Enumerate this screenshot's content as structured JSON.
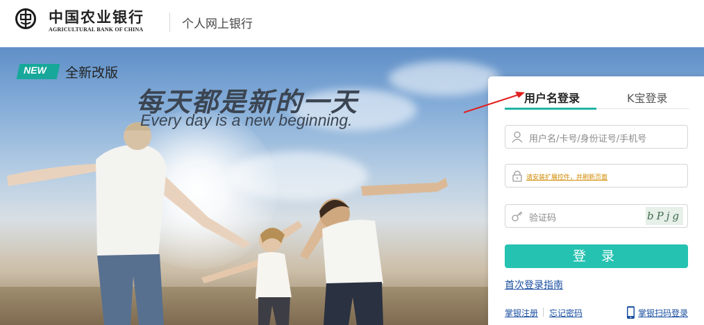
{
  "header": {
    "bank_name_cn": "中国农业银行",
    "bank_name_en": "AGRICULTURAL BANK OF CHINA",
    "section_title": "个人网上银行"
  },
  "banner": {
    "badge": "NEW",
    "badge_label": "全新改版",
    "slogan_cn": "每天都是新的一天",
    "slogan_en": "Every day is a new beginning."
  },
  "login": {
    "tabs": [
      {
        "label": "用户名登录",
        "active": true
      },
      {
        "label": "K宝登录",
        "active": false
      }
    ],
    "username_placeholder": "用户名/卡号/身份证号/手机号",
    "password_notice": "请安装扩展控件，并刷新页面",
    "captcha_placeholder": "验证码",
    "captcha_text": "bPjg",
    "login_button": "登 录",
    "first_login_guide": "首次登录指南",
    "register": "掌银注册",
    "forgot_password": "忘记密码",
    "scan_login": "掌银扫码登录"
  },
  "colors": {
    "accent": "#25c2b1",
    "link": "#1a4fa0",
    "warning_link": "#d08a00",
    "brand_green": "#17a89a",
    "annotation_arrow": "#e02020"
  },
  "icons": [
    "abc-logo-icon",
    "user-icon",
    "lock-icon",
    "key-icon",
    "phone-icon",
    "annotation-arrow-icon"
  ]
}
